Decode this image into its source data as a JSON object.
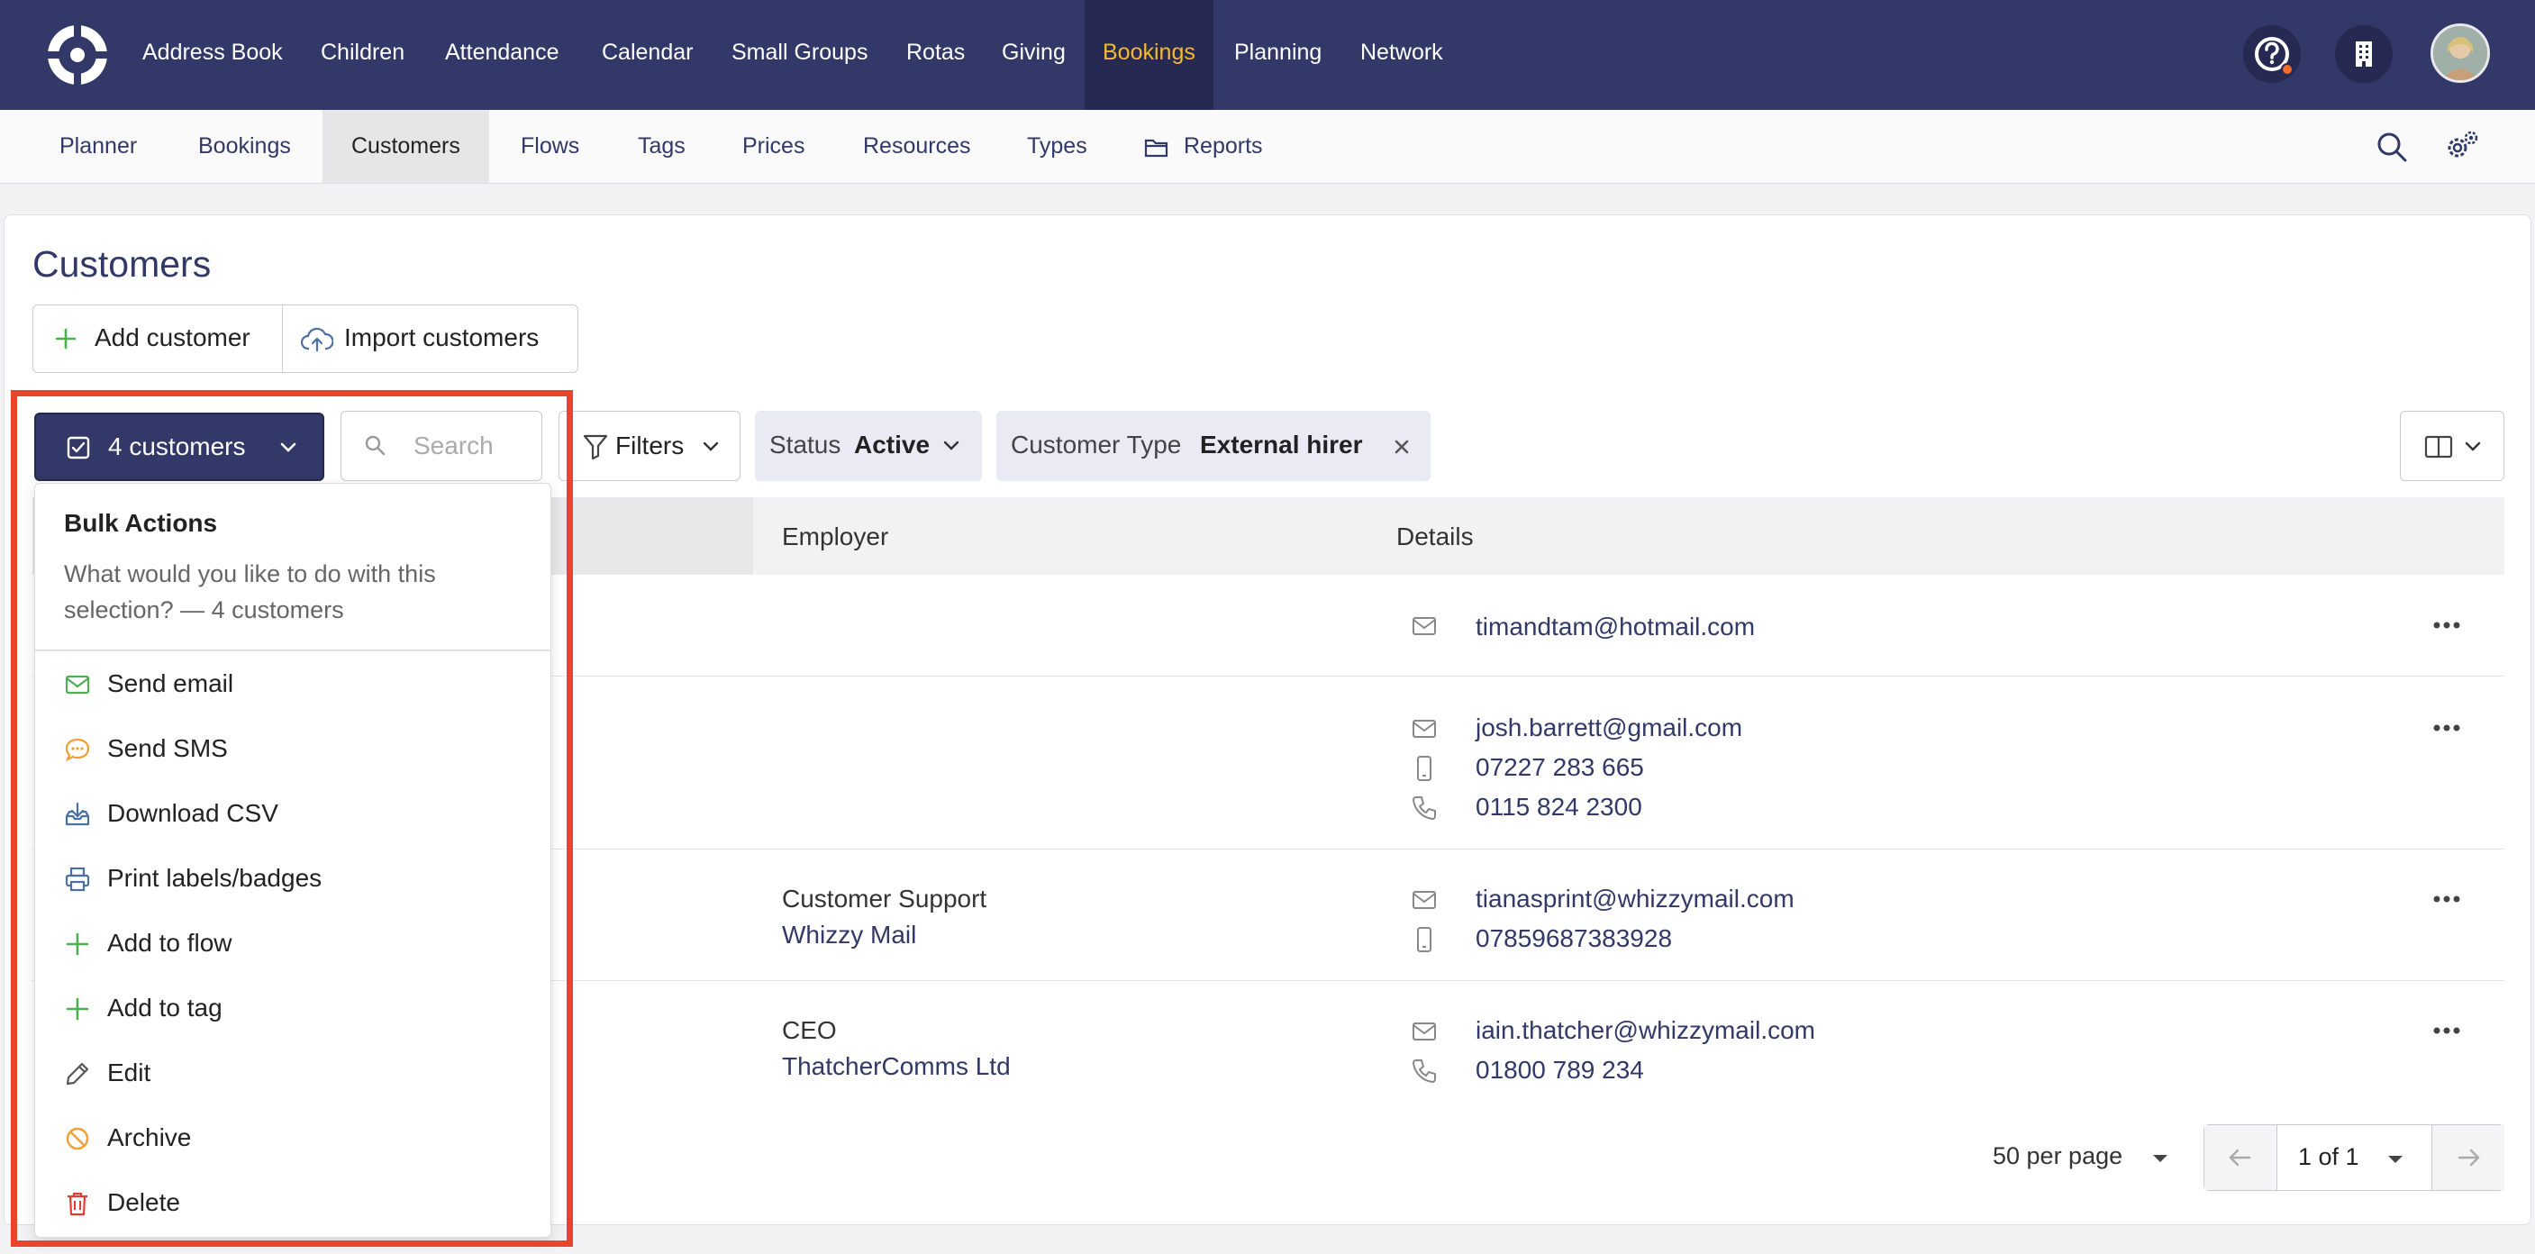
{
  "top_nav": {
    "items": [
      "Address Book",
      "Children",
      "Attendance",
      "Calendar",
      "Small Groups",
      "Rotas",
      "Giving",
      "Bookings",
      "Planning",
      "Network"
    ],
    "active": "Bookings",
    "icons": [
      "help-icon",
      "building-icon",
      "user-avatar"
    ]
  },
  "sub_nav": {
    "items": [
      "Planner",
      "Bookings",
      "Customers",
      "Flows",
      "Tags",
      "Prices",
      "Resources",
      "Types",
      "Reports"
    ],
    "active": "Customers",
    "icons": [
      "folder-icon",
      "search-icon",
      "settings-icon"
    ]
  },
  "page": {
    "title": "Customers",
    "add_customer": "Add customer",
    "import_customers": "Import customers"
  },
  "toolbar": {
    "bulk_label": "4 customers",
    "search_placeholder": "Search",
    "filters_label": "Filters",
    "status_chip": {
      "key": "Status",
      "value": "Active"
    },
    "type_chip": {
      "key": "Customer Type",
      "value": "External hirer"
    }
  },
  "table": {
    "headers": [
      "Employer",
      "Details"
    ],
    "rows": [
      {
        "employer_title": "",
        "employer_org": "",
        "details": [
          {
            "icon": "mail-icon",
            "text": "timandtam@hotmail.com"
          }
        ]
      },
      {
        "employer_title": "",
        "employer_org": "",
        "details": [
          {
            "icon": "mail-icon",
            "text": "josh.barrett@gmail.com"
          },
          {
            "icon": "mobile-icon",
            "text": "07227 283 665"
          },
          {
            "icon": "phone-icon",
            "text": "0115 824 2300"
          }
        ]
      },
      {
        "employer_title": "Customer Support",
        "employer_org": "Whizzy Mail",
        "details": [
          {
            "icon": "mail-icon",
            "text": "tianasprint@whizzymail.com"
          },
          {
            "icon": "mobile-icon",
            "text": "07859687383928"
          }
        ]
      },
      {
        "employer_title": "CEO",
        "employer_org": "ThatcherComms Ltd",
        "details": [
          {
            "icon": "mail-icon",
            "text": "iain.thatcher@whizzymail.com"
          },
          {
            "icon": "phone-icon",
            "text": "01800 789 234"
          }
        ]
      }
    ]
  },
  "pagination": {
    "per_page": "50 per page",
    "page": "1 of 1"
  },
  "bulk_actions": {
    "title": "Bulk Actions",
    "description": "What would you like to do with this selection? — 4 customers",
    "items": [
      {
        "label": "Send email",
        "icon": "mail-icon",
        "color": "#4caf50"
      },
      {
        "label": "Send SMS",
        "icon": "chat-icon",
        "color": "#f0a030"
      },
      {
        "label": "Download CSV",
        "icon": "download-icon",
        "color": "#4a6fa5"
      },
      {
        "label": "Print labels/badges",
        "icon": "printer-icon",
        "color": "#4a6fa5"
      },
      {
        "label": "Add to flow",
        "icon": "plus-icon",
        "color": "#4caf50"
      },
      {
        "label": "Add to tag",
        "icon": "plus-icon",
        "color": "#4caf50"
      },
      {
        "label": "Edit",
        "icon": "pencil-icon",
        "color": "#555555"
      },
      {
        "label": "Archive",
        "icon": "archive-icon",
        "color": "#f0a030"
      },
      {
        "label": "Delete",
        "icon": "trash-icon",
        "color": "#e53935"
      }
    ]
  },
  "colors": {
    "nav_bg": "#323867",
    "active_nav_text": "#f5b82e",
    "highlight": "#e8442e"
  }
}
